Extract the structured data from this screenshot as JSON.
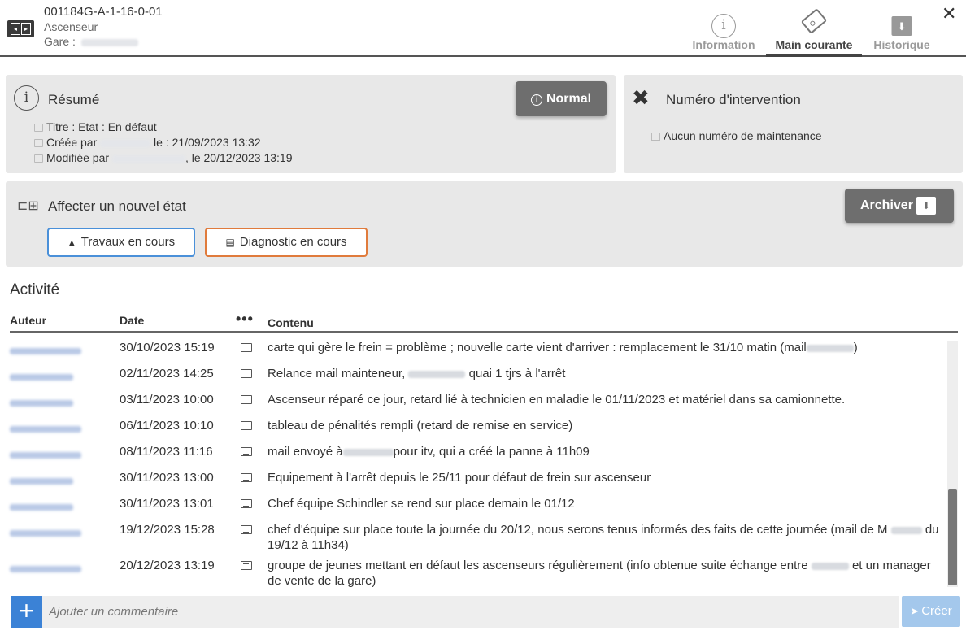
{
  "header": {
    "code": "001184G-A-1-16-0-01",
    "type": "Ascenseur",
    "gare_label": "Gare :",
    "tabs": [
      {
        "label": "Information"
      },
      {
        "label": "Main courante"
      },
      {
        "label": "Historique"
      }
    ],
    "active_tab": "Main courante",
    "close_label": "✕"
  },
  "resume": {
    "title": "Résumé",
    "status_button": "Normal",
    "titre_line": "Titre : Etat : En défaut",
    "creee_prefix": "Créée par",
    "creee_suffix": "le : 21/09/2023 13:32",
    "modifiee_prefix": "Modifiée par",
    "modifiee_suffix": ", le 20/12/2023 13:19"
  },
  "intervention": {
    "title": "Numéro d'intervention",
    "text": "Aucun numéro de maintenance"
  },
  "etat": {
    "title": "Affecter un nouvel état",
    "buttons": [
      {
        "label": "Travaux en cours",
        "color": "#4a90d9"
      },
      {
        "label": "Diagnostic en cours",
        "color": "#e07b3c"
      }
    ],
    "archive_label": "Archiver"
  },
  "activity": {
    "title": "Activité",
    "columns": {
      "auteur": "Auteur",
      "date": "Date",
      "dots": "•••",
      "contenu": "Contenu"
    },
    "rows": [
      {
        "date": "30/10/2023 15:19",
        "parts": [
          "carte qui gère le frein = problème ; nouvelle carte vient d'arriver : remplacement le 31/10 matin (mail",
          ")"
        ]
      },
      {
        "date": "02/11/2023 14:25",
        "parts": [
          "Relance mail mainteneur,",
          "quai 1 tjrs à l'arrêt"
        ]
      },
      {
        "date": "03/11/2023 10:00",
        "parts": [
          "Ascenseur réparé ce jour, retard lié à technicien en maladie le 01/11/2023 et matériel dans sa camionnette."
        ]
      },
      {
        "date": "06/11/2023 10:10",
        "parts": [
          "tableau de pénalités rempli (retard de remise en service)"
        ]
      },
      {
        "date": "08/11/2023 11:16",
        "parts": [
          "mail envoyé à",
          "pour itv, qui a créé la panne à 11h09"
        ]
      },
      {
        "date": "30/11/2023 13:00",
        "parts": [
          "Equipement à l'arrêt depuis le 25/11 pour défaut de frein sur ascenseur"
        ]
      },
      {
        "date": "30/11/2023 13:01",
        "parts": [
          "Chef équipe Schindler se rend sur place demain le 01/12"
        ]
      },
      {
        "date": "19/12/2023 15:28",
        "parts": [
          "chef d'équipe sur place toute la journée du 20/12, nous serons tenus informés des faits de cette journée (mail de M",
          "du 19/12 à 11h34)"
        ]
      },
      {
        "date": "20/12/2023 13:19",
        "parts": [
          "groupe de jeunes mettant en défaut les ascenseurs régulièrement (info obtenue suite échange entre",
          "et un manager de vente de la gare)"
        ]
      }
    ]
  },
  "footer": {
    "add_label": "+",
    "comment_placeholder": "Ajouter un commentaire",
    "send_label": "Créer"
  },
  "colors": {
    "accent": "#3b82d6",
    "status_button": "#6e6e6e",
    "panel_bg": "#e8e8e8"
  }
}
